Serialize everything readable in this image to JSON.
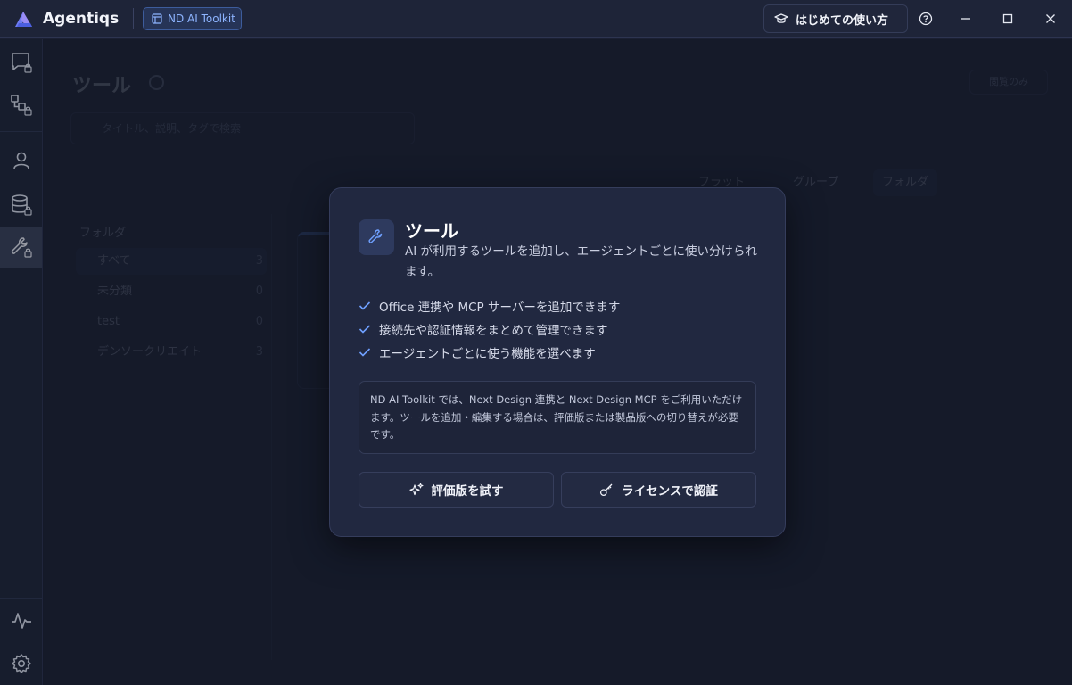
{
  "app": {
    "name": "Agentiqs",
    "toolkit_badge": "ND AI Toolkit",
    "guide_button": "はじめての使い方",
    "brand_color": "#7a7cf0"
  },
  "titlebar_icons": [
    "help-icon",
    "minimize-icon",
    "maximize-icon",
    "close-icon"
  ],
  "sidebar": {
    "items": [
      {
        "name": "chat-icon",
        "locked": true
      },
      {
        "name": "workflow-icon",
        "locked": true
      },
      {
        "name": "user-icon",
        "locked": false
      },
      {
        "name": "database-icon",
        "locked": true
      },
      {
        "name": "wrench-icon",
        "locked": true,
        "active": true
      },
      {
        "name": "activity-icon",
        "locked": false
      },
      {
        "name": "settings-icon",
        "locked": false
      }
    ]
  },
  "background": {
    "page_title": "ツール",
    "search_placeholder": "タイトル、説明、タグで検索",
    "edit_button": "閲覧のみ",
    "views": [
      "フラット",
      "グループ",
      "フォルダ"
    ],
    "folder_header": "フォルダ",
    "folders": [
      {
        "label": "すべて",
        "count": "3"
      },
      {
        "label": "未分類",
        "count": "0"
      },
      {
        "label": "test",
        "count": "0"
      },
      {
        "label": "デンソークリエイト",
        "count": "3"
      }
    ]
  },
  "modal": {
    "title": "ツール",
    "description": "AI が利用するツールを追加し、エージェントごとに使い分けられます。",
    "features": [
      "Office 連携や MCP サーバーを追加できます",
      "接続先や認証情報をまとめて管理できます",
      "エージェントごとに使う機能を選べます"
    ],
    "notice": "ND AI Toolkit では、Next Design 連携と Next Design MCP をご利用いただけます。ツールを追加・編集する場合は、評価版または製品版への切り替えが必要です。",
    "trial_button": "評価版を試す",
    "license_button": "ライセンスで認証",
    "accent_color": "#6fa0ff"
  }
}
